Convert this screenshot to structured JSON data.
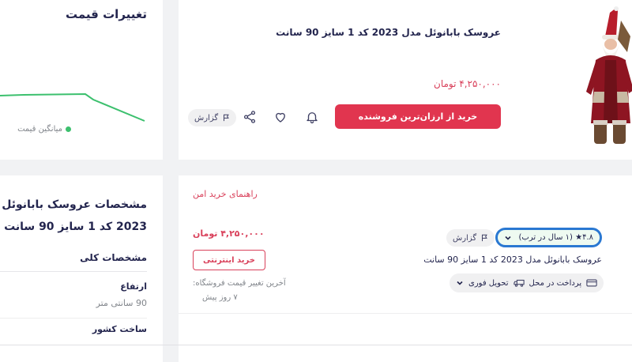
{
  "chart": {
    "title": "تغییرات قیمت",
    "legend_label": "میانگین قیمت",
    "line_color": "#3cc06e"
  },
  "product": {
    "title": "عروسک بابانوئل مدل 2023 کد 1 سایز 90 سانت",
    "price": "۴,۲۵۰,۰۰۰ تومان",
    "buy_cheapest_label": "خرید از ارزان‌ترین فروشنده",
    "report_label": "گزارش",
    "icons": [
      "bell-icon",
      "heart-icon",
      "share-icon",
      "flag-icon"
    ],
    "image": "santa-claus-doll"
  },
  "specs": {
    "title": "مشخصات عروسک بابانوئل مدل 2023 کد 1 سایز 90 سانت",
    "general_heading": "مشخصات کلی",
    "height_label": "ارتفاع",
    "height_value": "90 سانتی متر",
    "country_label": "ساخت کشور"
  },
  "seller": {
    "safe_guide": "راهنمای خرید امن",
    "price": "۴,۲۵۰,۰۰۰ تومان",
    "buy_online_label": "خرید اینترنتی",
    "last_change_label": "آخرین تغییر قیمت فروشگاه:",
    "last_change_value": "۷ روز پیش",
    "rating": "۴.۸★ (۱ سال در ترب)",
    "report_label": "گزارش",
    "product_name": "عروسک بابانوئل مدل 2023 کد 1 سایز 90 سانت",
    "delivery_label": "پرداخت در محل",
    "delivery_instant": "تحویل فوری"
  },
  "colors": {
    "accent": "#e1354f",
    "price": "#d9415b",
    "focus_outline": "#2a78d2",
    "background": "#f1f2f4"
  }
}
